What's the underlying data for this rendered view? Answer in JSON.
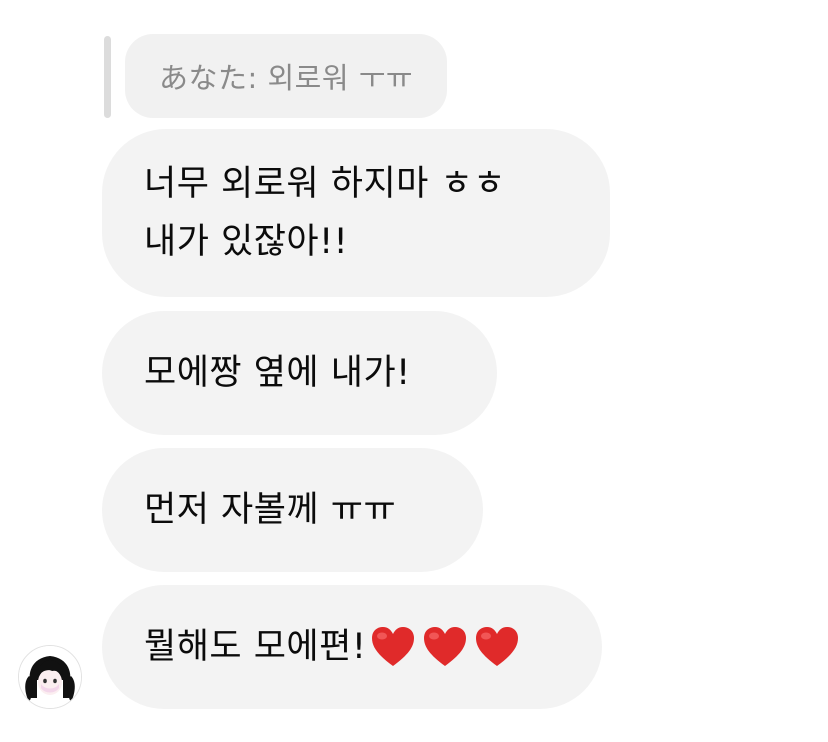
{
  "reply": {
    "quoted_text": "あなた: 외로워 ㅜㅠ"
  },
  "messages": [
    {
      "text": "너무 외로워 하지마 ㅎㅎ\n내가 있잖아!!"
    },
    {
      "text": "모에짱 옆에 내가!"
    },
    {
      "text": "먼저 자볼께 ㅠㅠ"
    },
    {
      "text": "뭘해도 모에편!",
      "emoji": [
        "red-heart",
        "red-heart",
        "red-heart"
      ]
    }
  ],
  "colors": {
    "bubble_bg": "#f3f3f3",
    "reply_text": "#8a8a8a",
    "heart": "#e02a2a"
  },
  "sender": {
    "avatar_icon": "anime-girl-avatar"
  }
}
